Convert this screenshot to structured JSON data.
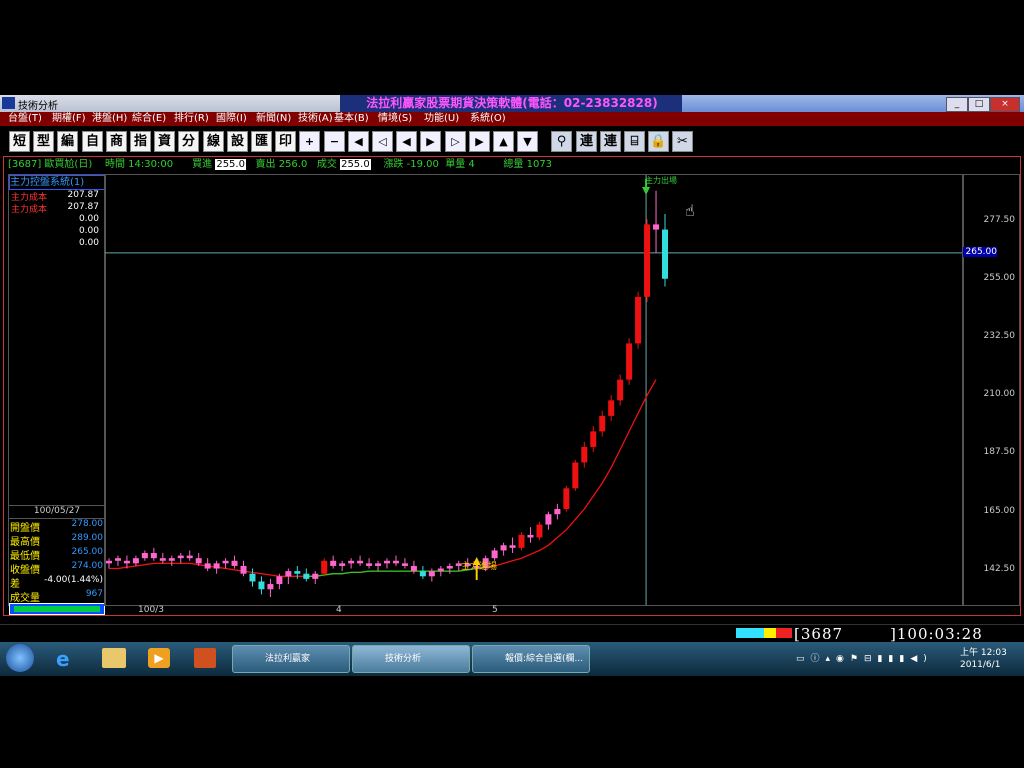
{
  "window": {
    "title": "技術分析",
    "center_title": "法拉利贏家股票期貨決策軟體(電話：02-23832828)",
    "controls": [
      "_",
      "□",
      "×"
    ]
  },
  "menu": [
    "台盤(T)",
    "期權(F)",
    "港盤(H)",
    "綜合(E)",
    "排行(R)",
    "國際(I)",
    "新聞(N)",
    "技術(A)",
    "基本(B)",
    "情境(S)",
    "功能(U)",
    "系統(O)"
  ],
  "toolbar": [
    "短",
    "型",
    "編",
    "自",
    "商",
    "指",
    "資",
    "分",
    "線",
    "設",
    "匯",
    "印",
    "+",
    "−",
    "◀",
    "◁",
    "◀",
    "▶",
    "▷",
    "▶",
    "▲",
    "▼",
    "⚲",
    "連",
    "連",
    "⌸",
    "🔒",
    "✂"
  ],
  "infobar": {
    "code": "[3687] 歐買尬(日)",
    "time_label": "時間",
    "time_value": "14:30:00",
    "bid_label": "買進",
    "bid_value": "255.0",
    "ask_label": "賣出",
    "ask_value": "256.0",
    "deal_label": "成交",
    "deal_value": "255.0",
    "change_label": "漲跌",
    "change_value": "-19.00",
    "volume_label": "單量",
    "volume_value": "4",
    "total_label": "總量",
    "total_value": "1073"
  },
  "left_panel": {
    "indicator_title": "主力控盤系統(1)",
    "rows": [
      {
        "label": "主力成本",
        "value": "207.87"
      },
      {
        "label": "主力成本",
        "value": "207.87"
      },
      {
        "label": "",
        "value": "0.00"
      },
      {
        "label": "",
        "value": "0.00"
      },
      {
        "label": "",
        "value": "0.00"
      }
    ],
    "date": "100/05/27",
    "quotes": [
      {
        "label": "開盤價",
        "value": "278.00"
      },
      {
        "label": "最高價",
        "value": "289.00"
      },
      {
        "label": "最低價",
        "value": "265.00"
      },
      {
        "label": "收盤價",
        "value": "274.00"
      },
      {
        "label": "差",
        "value": "-4.00(1.44%)"
      },
      {
        "label": "成交量",
        "value": "967"
      }
    ]
  },
  "chart": {
    "y_ticks": [
      "277.50",
      "255.00",
      "232.50",
      "210.00",
      "187.50",
      "165.00",
      "142.50"
    ],
    "y_current": "265.00",
    "x_ticks": [
      "100/3",
      "4",
      "5"
    ],
    "annotation_entry": "主力進場",
    "annotation_exit": "主力出場",
    "colors": {
      "up": "#ee1111",
      "down": "#33dddd",
      "up_small": "#ff66cc",
      "ma_red": "#ee1111",
      "ma_green": "#22cc22",
      "crosshair": "#66aaaa"
    }
  },
  "chart_data": {
    "type": "candlestick",
    "title": "",
    "ylim": [
      132,
      292
    ],
    "candles": [
      [
        145,
        147,
        143,
        146
      ],
      [
        146,
        148,
        144,
        147
      ],
      [
        146,
        148,
        143,
        145
      ],
      [
        145,
        148,
        144,
        147
      ],
      [
        147,
        150,
        146,
        149
      ],
      [
        149,
        151,
        146,
        147
      ],
      [
        147,
        149,
        145,
        146
      ],
      [
        146,
        148,
        144,
        147
      ],
      [
        147,
        149,
        145,
        148
      ],
      [
        148,
        150,
        146,
        147
      ],
      [
        147,
        149,
        144,
        145
      ],
      [
        145,
        147,
        142,
        143
      ],
      [
        143,
        146,
        141,
        145
      ],
      [
        145,
        147,
        143,
        146
      ],
      [
        146,
        148,
        143,
        144
      ],
      [
        144,
        146,
        140,
        141
      ],
      [
        141,
        143,
        136,
        138
      ],
      [
        138,
        140,
        133,
        135
      ],
      [
        135,
        139,
        132,
        137
      ],
      [
        137,
        141,
        135,
        140
      ],
      [
        140,
        143,
        137,
        142
      ],
      [
        142,
        144,
        139,
        141
      ],
      [
        141,
        143,
        138,
        139
      ],
      [
        139,
        142,
        137,
        141
      ],
      [
        141,
        147,
        140,
        146
      ],
      [
        146,
        148,
        143,
        144
      ],
      [
        144,
        146,
        142,
        145
      ],
      [
        145,
        147,
        143,
        146
      ],
      [
        146,
        148,
        144,
        145
      ],
      [
        145,
        147,
        143,
        144
      ],
      [
        144,
        146,
        142,
        145
      ],
      [
        145,
        147,
        143,
        146
      ],
      [
        146,
        148,
        144,
        145
      ],
      [
        145,
        147,
        143,
        144
      ],
      [
        144,
        146,
        141,
        142
      ],
      [
        142,
        144,
        139,
        140
      ],
      [
        140,
        143,
        138,
        142
      ],
      [
        142,
        144,
        140,
        143
      ],
      [
        143,
        145,
        141,
        144
      ],
      [
        144,
        146,
        142,
        145
      ],
      [
        145,
        147,
        143,
        144
      ],
      [
        144,
        146,
        142,
        143
      ],
      [
        143,
        148,
        142,
        147
      ],
      [
        147,
        151,
        146,
        150
      ],
      [
        150,
        153,
        148,
        152
      ],
      [
        152,
        155,
        149,
        151
      ],
      [
        151,
        157,
        150,
        156
      ],
      [
        156,
        159,
        153,
        155
      ],
      [
        155,
        161,
        154,
        160
      ],
      [
        160,
        165,
        158,
        164
      ],
      [
        164,
        168,
        162,
        166
      ],
      [
        166,
        175,
        165,
        174
      ],
      [
        174,
        185,
        173,
        184
      ],
      [
        184,
        192,
        182,
        190
      ],
      [
        190,
        198,
        188,
        196
      ],
      [
        196,
        204,
        194,
        202
      ],
      [
        202,
        210,
        200,
        208
      ],
      [
        208,
        218,
        206,
        216
      ],
      [
        216,
        232,
        214,
        230
      ],
      [
        230,
        250,
        228,
        248
      ],
      [
        248,
        278,
        246,
        276
      ],
      [
        276,
        289,
        265,
        274
      ],
      [
        274,
        280,
        252,
        255
      ]
    ],
    "ma_red": [
      143,
      143,
      143.5,
      144,
      144.5,
      145,
      145,
      145,
      145,
      145,
      144.5,
      144,
      143.5,
      143,
      142.5,
      142,
      141.5,
      141,
      140.5,
      140,
      140,
      140,
      140,
      140,
      140.5,
      141,
      141,
      141.5,
      141.5,
      142,
      142,
      142,
      142,
      142,
      142,
      142,
      142,
      142,
      142,
      142,
      142.5,
      143,
      143.5,
      144,
      145,
      146,
      147,
      148.5,
      150,
      152,
      155,
      158,
      162,
      166,
      171,
      176,
      182,
      189,
      196,
      203,
      210,
      216
    ],
    "ma_green_end_index": 42,
    "entry_index": 41,
    "exit_index": 60
  },
  "status": {
    "code": "3687_",
    "clock": "100:03:28"
  },
  "taskbar": {
    "tasks": [
      "法拉利贏家",
      "技術分析",
      "報價:綜合自選(欄..."
    ],
    "time": "上午 12:03",
    "date": "2011/6/1"
  }
}
